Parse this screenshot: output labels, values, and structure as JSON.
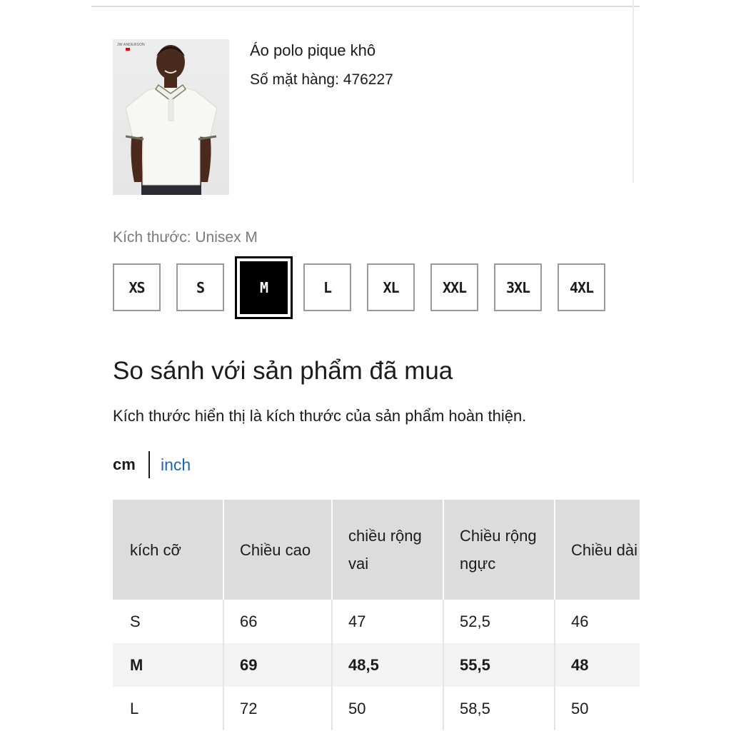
{
  "product": {
    "name": "Áo polo pique khô",
    "item_number_label": "Số mặt hàng:",
    "item_number": "476227",
    "image_brand_text": "JW ANDERSON"
  },
  "size_selector": {
    "label": "Kích thước:",
    "selected_value": "Unisex M",
    "options": [
      "XS",
      "S",
      "M",
      "L",
      "XL",
      "XXL",
      "3XL",
      "4XL"
    ],
    "selected_index": 2
  },
  "comparison": {
    "heading": "So sánh với sản phẩm đã mua",
    "note": "Kích thước hiển thị là kích thước của sản phẩm hoàn thiện.",
    "units": {
      "active": "cm",
      "inactive": "inch"
    },
    "table": {
      "headers": [
        "kích cỡ",
        "Chiều cao",
        "chiều rộng vai",
        "Chiều rộng ngực",
        "Chiều dài tay áo"
      ],
      "rows": [
        [
          "S",
          "66",
          "47",
          "52,5",
          "46"
        ],
        [
          "M",
          "69",
          "48,5",
          "55,5",
          "48"
        ],
        [
          "L",
          "72",
          "50",
          "58,5",
          "50"
        ]
      ],
      "highlight_row": 1
    }
  },
  "colors": {
    "accent_link": "#1e63b5",
    "selected_chip_bg": "#000000",
    "header_bg": "#dcdcdc"
  }
}
